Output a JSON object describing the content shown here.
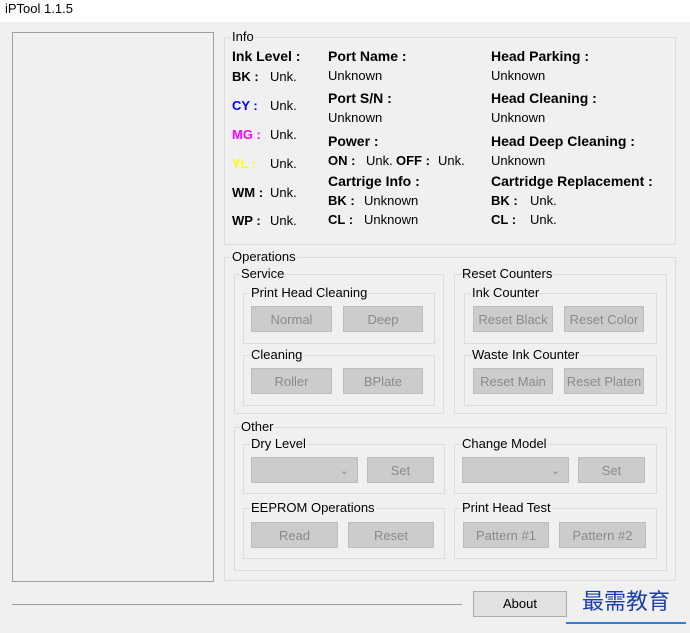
{
  "window": {
    "title": "iPTool 1.1.5"
  },
  "info": {
    "legend": "Info",
    "ink_level": {
      "title": "Ink Level :",
      "rows": [
        {
          "key": "BK :",
          "value": "Unk.",
          "color": "#000000"
        },
        {
          "key": "CY :",
          "value": "Unk.",
          "color": "#0000ff"
        },
        {
          "key": "MG :",
          "value": "Unk.",
          "color": "#ff00ff"
        },
        {
          "key": "YL :",
          "value": "Unk.",
          "color": "#ffff00"
        },
        {
          "key": "WM :",
          "value": "Unk.",
          "color": "#000000"
        },
        {
          "key": "WP :",
          "value": "Unk.",
          "color": "#000000"
        }
      ]
    },
    "port_name": {
      "title": "Port Name :",
      "value": "Unknown"
    },
    "port_sn": {
      "title": "Port S/N :",
      "value": "Unknown"
    },
    "power": {
      "title": "Power :",
      "on_key": "ON :",
      "on_value": "Unk.",
      "off_key": "OFF :",
      "off_value": "Unk."
    },
    "cartrige_info": {
      "title": "Cartrige Info :",
      "bk_key": "BK :",
      "bk_value": "Unknown",
      "cl_key": "CL :",
      "cl_value": "Unknown"
    },
    "head_parking": {
      "title": "Head Parking :",
      "value": "Unknown"
    },
    "head_cleaning": {
      "title": "Head Cleaning :",
      "value": "Unknown"
    },
    "head_deep_cleaning": {
      "title": "Head Deep Cleaning :",
      "value": "Unknown"
    },
    "cartridge_replacement": {
      "title": "Cartridge Replacement :",
      "bk_key": "BK :",
      "bk_value": "Unk.",
      "cl_key": "CL :",
      "cl_value": "Unk."
    }
  },
  "operations": {
    "legend": "Operations",
    "service": {
      "legend": "Service",
      "print_head_cleaning": {
        "legend": "Print Head Cleaning",
        "normal": "Normal",
        "deep": "Deep"
      },
      "cleaning": {
        "legend": "Cleaning",
        "roller": "Roller",
        "bplate": "BPlate"
      }
    },
    "reset_counters": {
      "legend": "Reset Counters",
      "ink_counter": {
        "legend": "Ink Counter",
        "reset_black": "Reset Black",
        "reset_color": "Reset Color"
      },
      "waste_ink_counter": {
        "legend": "Waste Ink Counter",
        "reset_main": "Reset Main",
        "reset_platen": "Reset Platen"
      }
    },
    "other": {
      "legend": "Other",
      "dry_level": {
        "legend": "Dry Level",
        "set": "Set"
      },
      "change_model": {
        "legend": "Change Model",
        "set": "Set"
      },
      "eeprom": {
        "legend": "EEPROM Operations",
        "read": "Read",
        "reset": "Reset"
      },
      "print_head_test": {
        "legend": "Print Head Test",
        "pattern1": "Pattern #1",
        "pattern2": "Pattern #2"
      }
    }
  },
  "footer": {
    "about": "About"
  },
  "watermark": {
    "text": "最需教育"
  }
}
